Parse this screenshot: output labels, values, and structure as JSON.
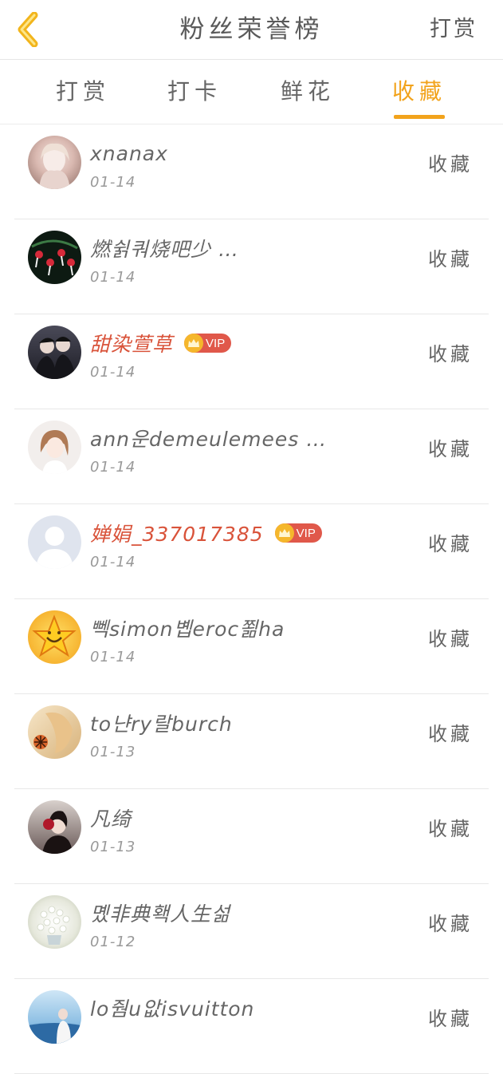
{
  "header": {
    "back_icon": "chevron-left-icon",
    "title": "粉丝荣誉榜",
    "action_label": "打赏"
  },
  "tabs": [
    {
      "label": "打赏",
      "active": false
    },
    {
      "label": "打卡",
      "active": false
    },
    {
      "label": "鲜花",
      "active": false
    },
    {
      "label": "收藏",
      "active": true
    }
  ],
  "colors": {
    "accent": "#f2a31c",
    "vip_name": "#d9533a",
    "vip_badge": "#e0584a"
  },
  "list": [
    {
      "name": "xnanax",
      "date": "01-14",
      "vip": false,
      "action": "收藏"
    },
    {
      "name": "燃쉵쿼烧吧少 …",
      "date": "01-14",
      "vip": false,
      "action": "收藏"
    },
    {
      "name": "甜染萱草",
      "date": "01-14",
      "vip": true,
      "vip_label": "VIP",
      "action": "收藏"
    },
    {
      "name": "ann운demeulemees …",
      "date": "01-14",
      "vip": false,
      "action": "收藏"
    },
    {
      "name": "婵娟_337017385",
      "date": "01-14",
      "vip": true,
      "vip_label": "VIP",
      "action": "收藏"
    },
    {
      "name": "뻭simon볩eroc쬚ha",
      "date": "01-14",
      "vip": false,
      "action": "收藏"
    },
    {
      "name": "to냔ry랄burch",
      "date": "01-13",
      "vip": false,
      "action": "收藏"
    },
    {
      "name": "凡绮",
      "date": "01-13",
      "vip": false,
      "action": "收藏"
    },
    {
      "name": "몠非典홱人生섦",
      "date": "01-12",
      "vip": false,
      "action": "收藏"
    },
    {
      "name": "lo줨u앖isvuitton",
      "date": "",
      "vip": false,
      "action": "收藏"
    }
  ]
}
